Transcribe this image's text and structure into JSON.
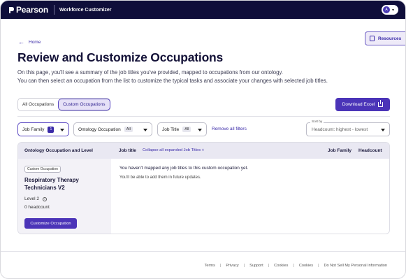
{
  "header": {
    "brand": "Pearson",
    "product": "Workforce Customizer",
    "user_initial": "A"
  },
  "resources_label": "Resources",
  "nav": {
    "home_label": "Home"
  },
  "page": {
    "title": "Review and Customize Occupations",
    "description_line1": "On this page, you'll see a summary of the job titles you've provided, mapped to occupations from our ontology.",
    "description_line2": "You can then select an occupation from the list to customize the typical tasks and associate your changes with selected job titles."
  },
  "tabs": [
    "All Occupations",
    "Custom Occupations"
  ],
  "active_tab": "Custom Occupations",
  "download_label": "Download Excel",
  "filters": {
    "job_family": {
      "label": "Job Family",
      "count": "1"
    },
    "ontology_occupation": {
      "label": "Ontology Occupation",
      "value": "All"
    },
    "job_title": {
      "label": "Job Title",
      "value": "All"
    },
    "remove_all": "Remove all filters"
  },
  "sort": {
    "label": "Sort by",
    "value": "Headcount: highest - lowest"
  },
  "table": {
    "headers": {
      "occupation": "Ontology Occupation and Level",
      "job_title": "Job title",
      "collapse": "Collapse all expanded Job Titles",
      "job_family": "Job Family",
      "headcount": "Headcount"
    },
    "row": {
      "badge": "Custom Occupation",
      "title": "Respiratory Therapy Technicians V2",
      "level": "Level 2",
      "headcount": "0 headcount",
      "button": "Customize Occupation",
      "message": "You haven't mapped any job titles to this custom occupation yet.",
      "submessage": "You'll be able to add them in future updates."
    }
  },
  "footer": [
    "Terms",
    "Privacy",
    "Support",
    "Cookies",
    "Cookies",
    "Do Not Sell My Personal Information"
  ],
  "colors": {
    "brand_navy": "#0f0e3a",
    "accent": "#4b34b8"
  }
}
